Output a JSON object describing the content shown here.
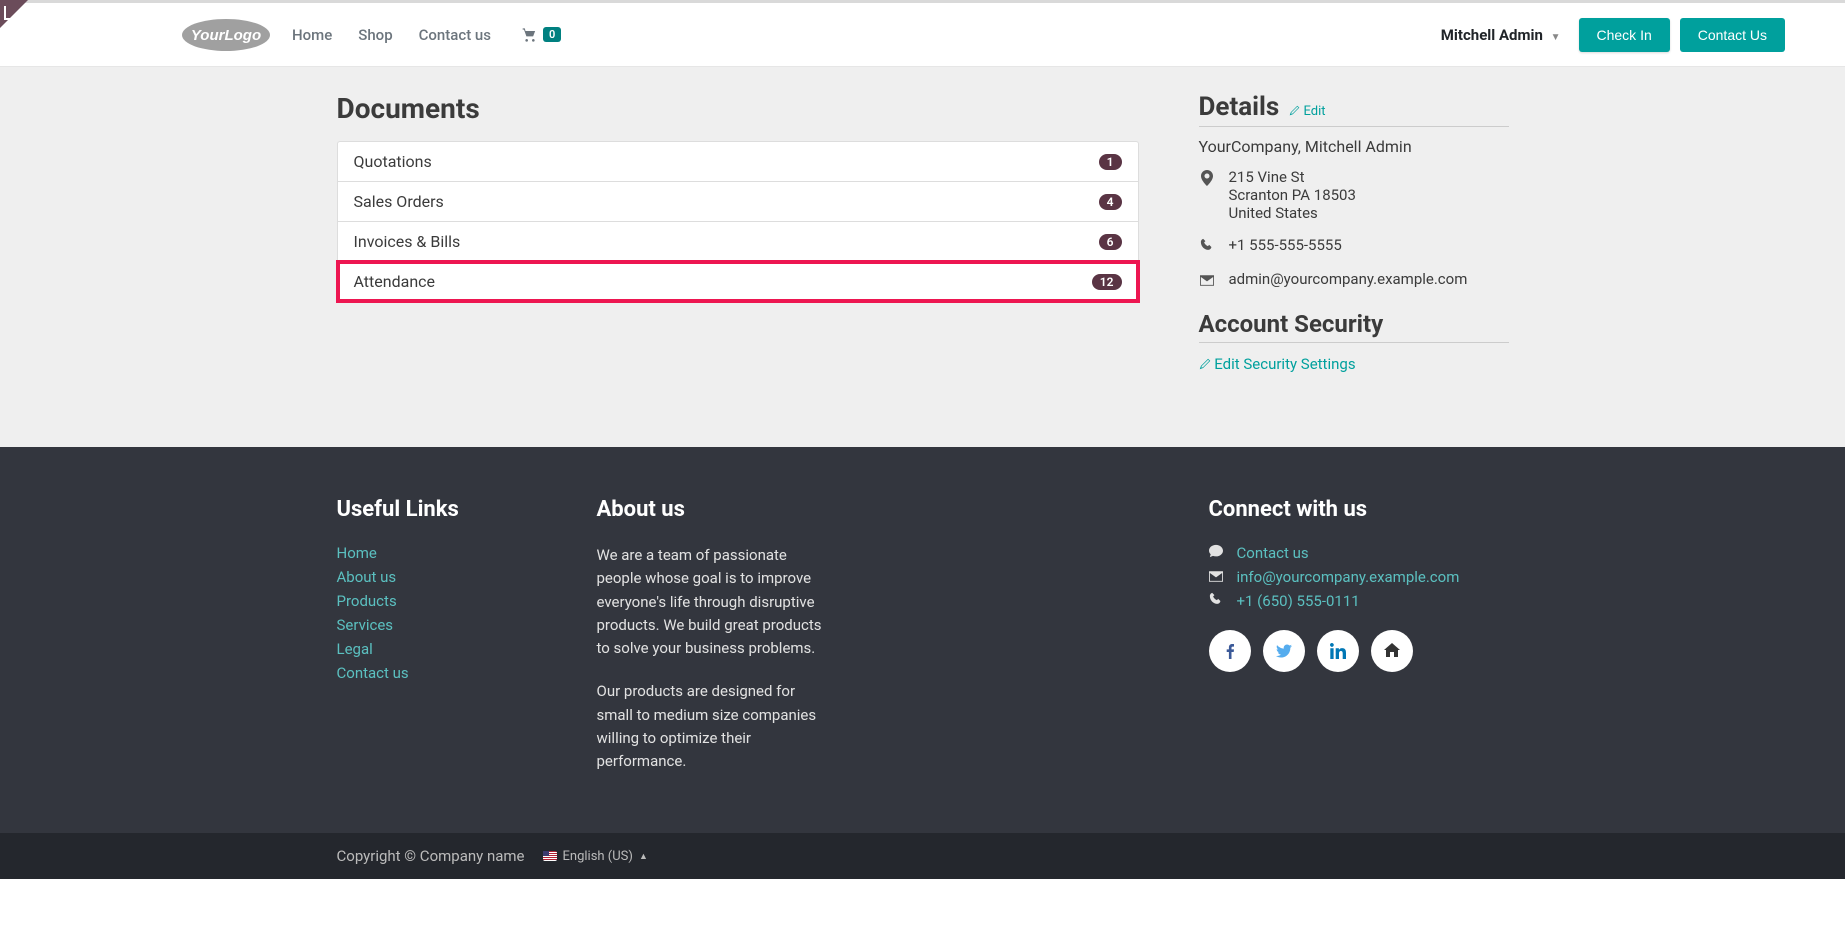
{
  "nav": {
    "home": "Home",
    "shop": "Shop",
    "contact": "Contact us",
    "cart_count": "0"
  },
  "user": {
    "name": "Mitchell Admin"
  },
  "buttons": {
    "check_in": "Check In",
    "contact_us": "Contact Us"
  },
  "documents": {
    "title": "Documents",
    "items": [
      {
        "label": "Quotations",
        "count": "1"
      },
      {
        "label": "Sales Orders",
        "count": "4"
      },
      {
        "label": "Invoices & Bills",
        "count": "6"
      },
      {
        "label": "Attendance",
        "count": "12",
        "highlighted": true
      }
    ]
  },
  "details": {
    "title": "Details",
    "edit": "Edit",
    "name": "YourCompany, Mitchell Admin",
    "address_line1": "215 Vine St",
    "address_line2": "Scranton PA 18503",
    "address_line3": "United States",
    "phone": "+1 555-555-5555",
    "email": "admin@yourcompany.example.com"
  },
  "security": {
    "title": "Account Security",
    "link": "Edit Security Settings"
  },
  "footer": {
    "useful_title": "Useful Links",
    "links": {
      "home": "Home",
      "about": "About us",
      "products": "Products",
      "services": "Services",
      "legal": "Legal",
      "contact": "Contact us"
    },
    "about_title": "About us",
    "about_p1": "We are a team of passionate people whose goal is to improve everyone's life through disruptive products. We build great products to solve your business problems.",
    "about_p2": "Our products are designed for small to medium size companies willing to optimize their performance.",
    "connect_title": "Connect with us",
    "connect_contact": "Contact us",
    "connect_email": "info@yourcompany.example.com",
    "connect_phone": "+1 (650) 555-0111"
  },
  "bottom": {
    "copyright": "Copyright © Company name",
    "lang": "English (US)"
  }
}
